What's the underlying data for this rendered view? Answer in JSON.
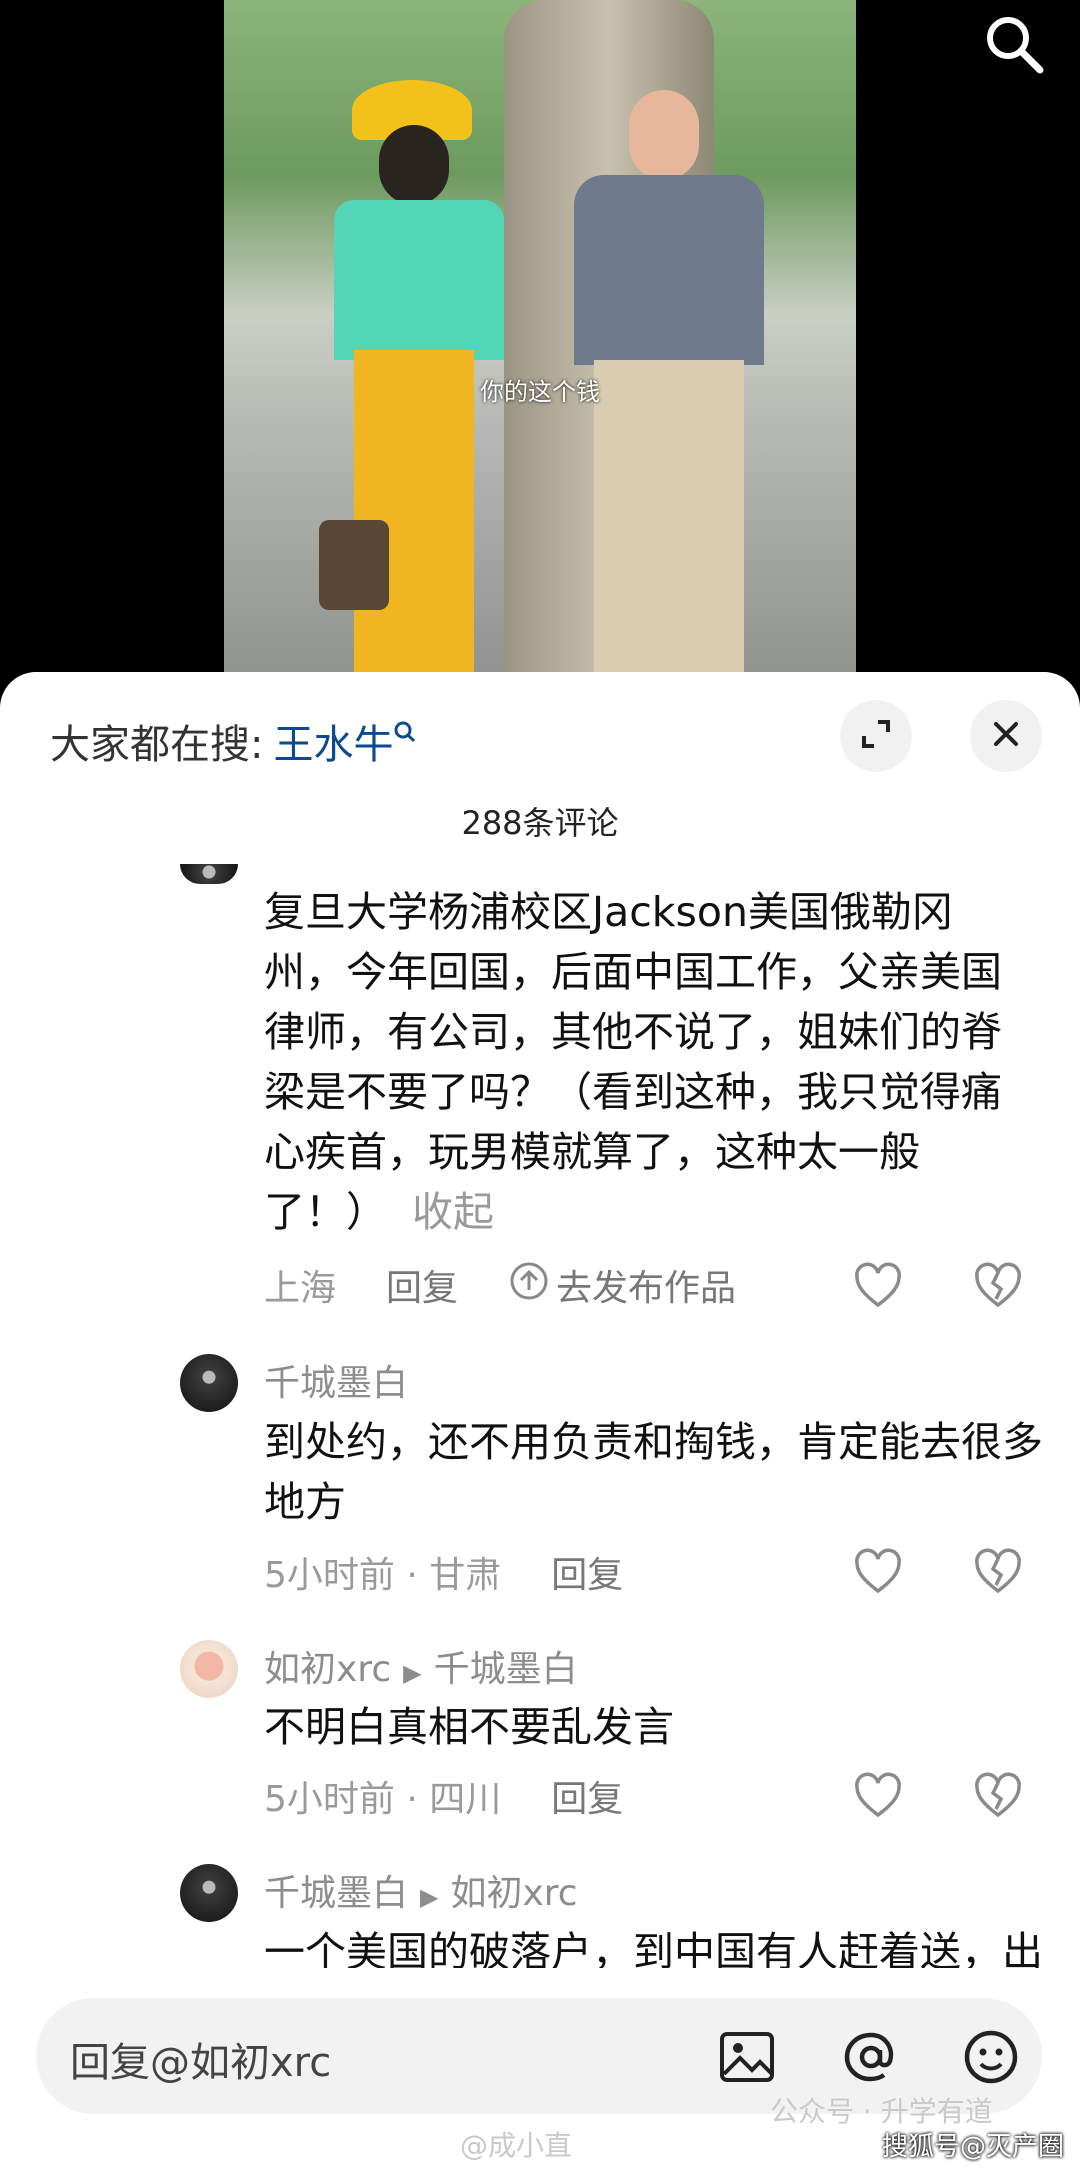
{
  "video": {
    "subtitle": "你的这个钱"
  },
  "sheet": {
    "hot_search_prefix": "大家都在搜:",
    "hot_search_keyword": "王水牛",
    "comment_count": "288条评论",
    "comments": [
      {
        "text": "复旦大学杨浦校区Jackson美国俄勒冈州，今年回国，后面中国工作，父亲美国律师，有公司，其他不说了，姐妹们的脊梁是不要了吗？（看到这种，我只觉得痛心疾首，玩男模就算了，这种太一般了！）",
        "fold": "收起",
        "location": "上海",
        "reply": "回复",
        "publish": "去发布作品"
      },
      {
        "name": "千城墨白",
        "text": "到处约，还不用负责和掏钱，肯定能去很多地方",
        "time": "5小时前 · 甘肃",
        "reply": "回复"
      },
      {
        "name": "如初xrc",
        "reply_to": "千城墨白",
        "text": "不明白真相不要乱发言",
        "time": "5小时前 · 四川",
        "reply": "回复"
      },
      {
        "name": "千城墨白",
        "reply_to": "如初xrc",
        "text": "一个美国的破落户，到中国有人赶着送，出门生活，你搜搜，我也是刚看到",
        "time": "",
        "reply": ""
      }
    ]
  },
  "reply_bar": {
    "label": "回复@如初xrc"
  },
  "watermarks": {
    "weibo": "@成小直",
    "wechat": "公众号 · 升学有道",
    "sohu": "搜狐号@灭产圈"
  }
}
